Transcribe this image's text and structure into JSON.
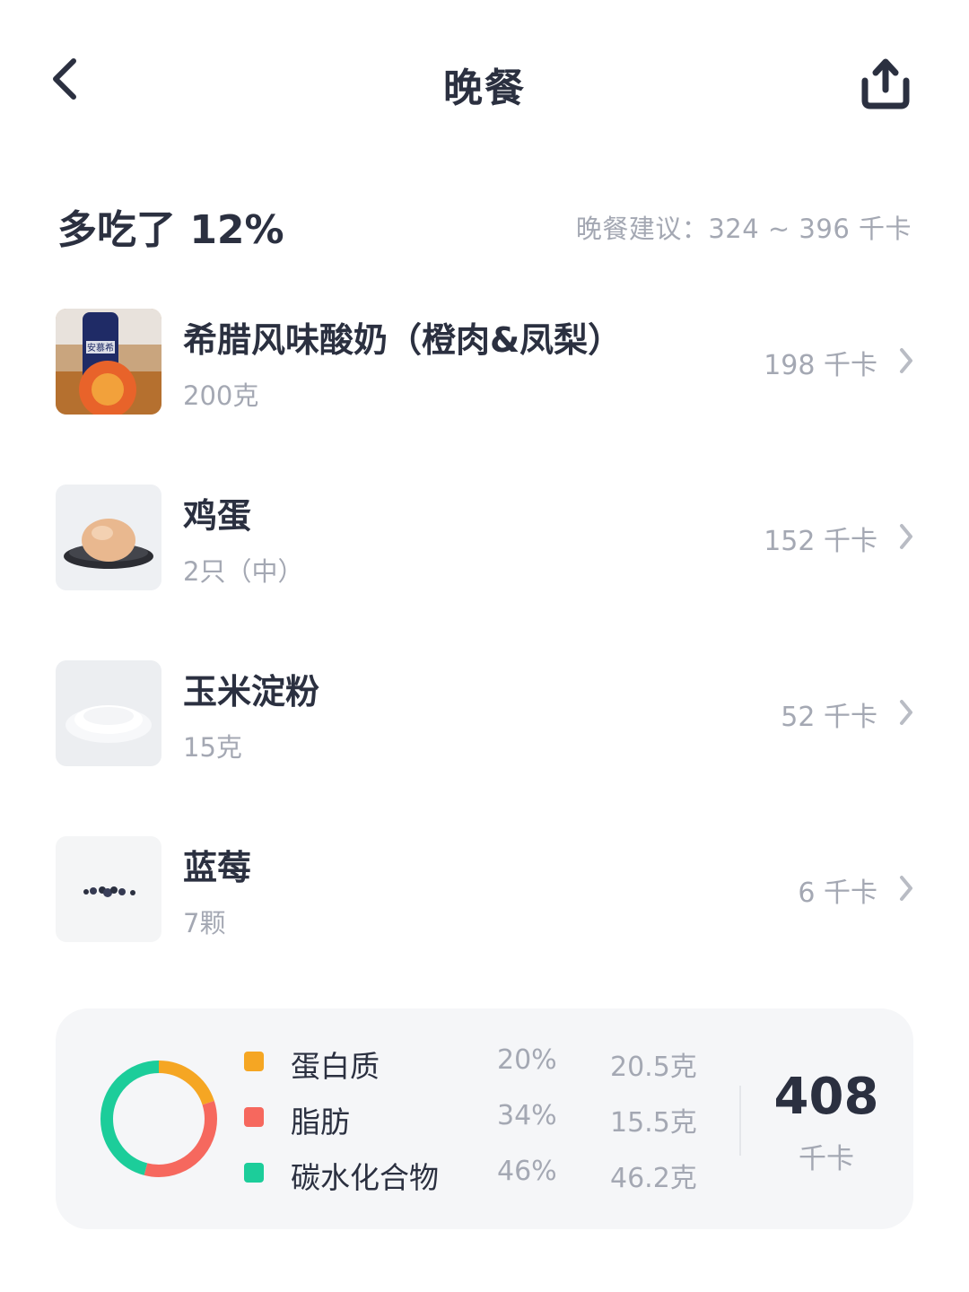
{
  "header": {
    "title": "晚餐",
    "back_icon": "chevron-left-icon",
    "share_icon": "share-upload-icon"
  },
  "summary": {
    "over_text": "多吃了 12%",
    "suggestion": "晚餐建议：324 ~ 396 千卡"
  },
  "foods": [
    {
      "name": "希腊风味酸奶（橙肉&凤梨）",
      "amount": "200克",
      "kcal": "198 千卡",
      "thumb_label": "安慕希"
    },
    {
      "name": "鸡蛋",
      "amount": "2只（中）",
      "kcal": "152 千卡"
    },
    {
      "name": "玉米淀粉",
      "amount": "15克",
      "kcal": "52 千卡"
    },
    {
      "name": "蓝莓",
      "amount": "7颗",
      "kcal": "6 千卡"
    }
  ],
  "nutrition": {
    "items": [
      {
        "label": "蛋白质",
        "percent": "20%",
        "grams": "20.5克",
        "color": "#f5a623",
        "share": 0.2
      },
      {
        "label": "脂肪",
        "percent": "34%",
        "grams": "15.5克",
        "color": "#f6685e",
        "share": 0.34
      },
      {
        "label": "碳水化合物",
        "percent": "46%",
        "grams": "46.2克",
        "color": "#1ccd9a",
        "share": 0.46
      }
    ],
    "total_kcal": "408",
    "total_unit": "千卡"
  }
}
